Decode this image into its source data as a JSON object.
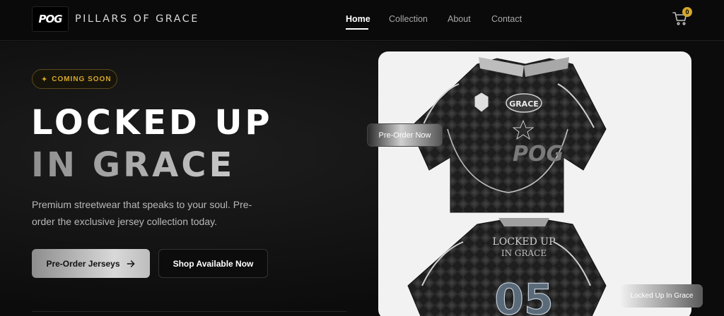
{
  "nav": {
    "logo_text": "POG",
    "brand": "PILLARS OF GRACE",
    "links": [
      "Home",
      "Collection",
      "About",
      "Contact"
    ],
    "active": "Home",
    "cart_count": "0"
  },
  "hero": {
    "badge_icon": "sparkle-icon",
    "badge": "COMING SOON",
    "title_line1": "LOCKED UP",
    "title_line2": "IN GRACE",
    "description": "Premium streetwear that speaks to your soul. Pre-order the exclusive jersey collection today.",
    "primary_cta": "Pre-Order Jerseys",
    "primary_cta_icon": "arrow-right-icon",
    "secondary_cta": "Shop Available Now"
  },
  "showcase": {
    "front_badge": "GRACE",
    "front_logo": "POG",
    "back_text_line1": "LOCKED UP",
    "back_text_line2": "IN GRACE",
    "back_number": "05",
    "float_label_1": "Pre-Order Now",
    "float_label_2": "Locked Up In Grace"
  },
  "colors": {
    "accent_gold": "#d4a72c",
    "background": "#0b0b0b",
    "card": "#f2f2f2"
  }
}
